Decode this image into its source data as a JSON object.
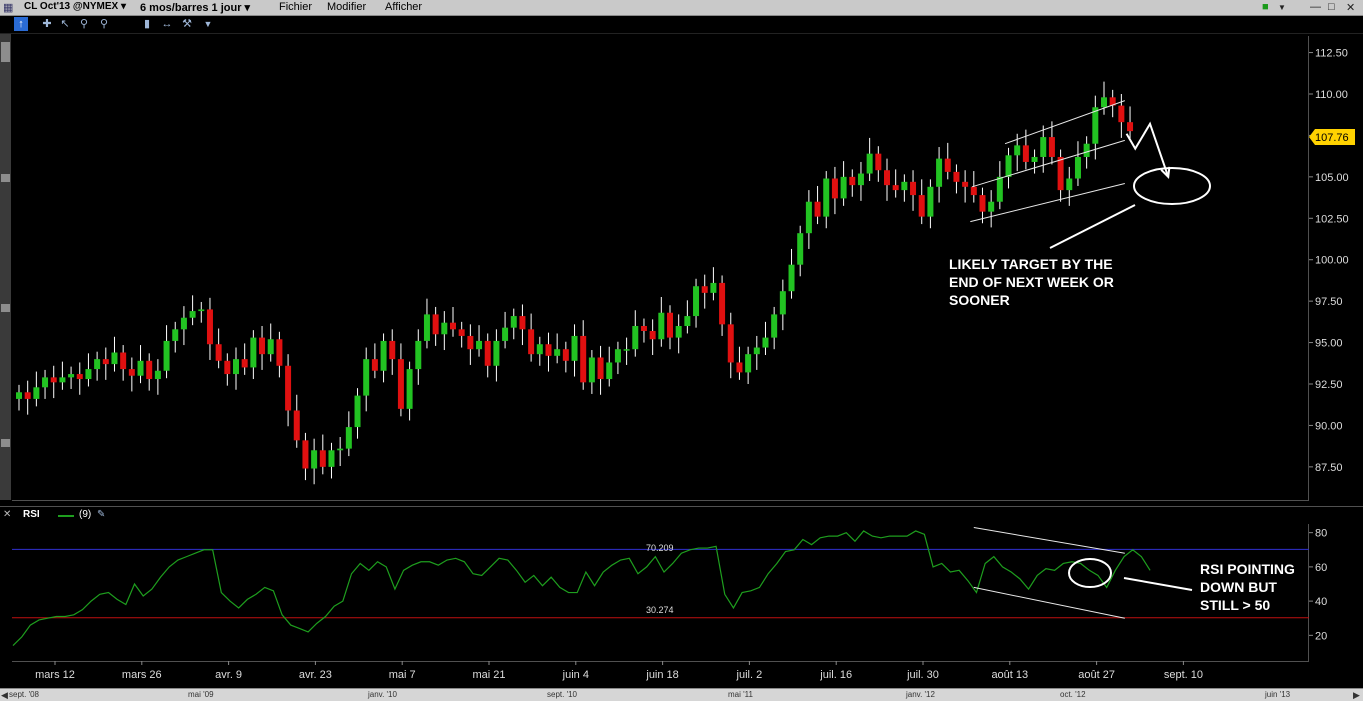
{
  "app": {
    "symbol_menu": "CL Oct'13 @NYMEX",
    "period_menu": "6 mos/barres 1 jour",
    "menu_items": [
      "Fichier",
      "Modifier",
      "Afficher"
    ]
  },
  "price_panel": {
    "last_price_label": "107.76",
    "y_ticks": [
      "112.50",
      "110.00",
      "107.50",
      "105.00",
      "102.50",
      "100.00",
      "97.50",
      "95.00",
      "92.50",
      "90.00",
      "87.50"
    ],
    "annotation": [
      "LIKELY TARGET BY THE",
      "END OF NEXT WEEK OR",
      "SOONER"
    ]
  },
  "rsi_panel": {
    "indicator_label": "RSI",
    "period_label": "(9)",
    "y_ticks": [
      "80",
      "60",
      "40",
      "20"
    ],
    "upper_level_label": "70.209",
    "lower_level_label": "30.274",
    "annotation": [
      "RSI POINTING",
      "DOWN BUT",
      "STILL > 50"
    ]
  },
  "x_axis": {
    "ticks": [
      "mars 12",
      "mars 26",
      "avr. 9",
      "avr. 23",
      "mai 7",
      "mai 21",
      "juin 4",
      "juin 18",
      "juil. 2",
      "juil. 16",
      "juil. 30",
      "août 13",
      "août 27",
      "sept. 10"
    ]
  },
  "overview_scroll": {
    "ticks": [
      "sept. '08",
      "mai '09",
      "janv. '10",
      "sept. '10",
      "mai '11",
      "janv. '12",
      "oct. '12",
      "juin '13"
    ]
  },
  "colors": {
    "up_candle": "#22c322",
    "down_candle": "#e01010",
    "wick": "#ffffff",
    "rsi_line": "#1e9e1e",
    "rsi_upper": "#3030d0",
    "rsi_lower": "#c01010",
    "price_tag": "#ffd200"
  },
  "chart_data": [
    {
      "type": "candlestick",
      "ylim": [
        85.5,
        113.5
      ],
      "closes": [
        92.0,
        91.6,
        92.3,
        92.9,
        92.6,
        92.9,
        93.1,
        92.8,
        93.4,
        94.0,
        93.7,
        94.4,
        93.4,
        93.0,
        93.9,
        92.8,
        93.3,
        95.1,
        95.8,
        96.5,
        96.9,
        97.0,
        94.9,
        93.9,
        93.1,
        94.0,
        93.5,
        95.3,
        94.3,
        95.2,
        93.6,
        90.9,
        89.1,
        87.4,
        88.5,
        87.5,
        88.5,
        88.6,
        89.9,
        91.8,
        94.0,
        93.3,
        95.1,
        94.0,
        91.0,
        93.4,
        95.1,
        96.7,
        95.5,
        96.2,
        95.8,
        95.4,
        94.6,
        95.1,
        93.6,
        95.1,
        95.9,
        96.6,
        95.8,
        94.3,
        94.9,
        94.2,
        94.6,
        93.9,
        95.4,
        92.6,
        94.1,
        92.8,
        93.8,
        94.6,
        94.6,
        96.0,
        95.7,
        95.2,
        96.8,
        95.3,
        96.0,
        96.6,
        98.4,
        98.0,
        98.6,
        96.1,
        93.8,
        93.2,
        94.3,
        94.7,
        95.3,
        96.7,
        98.1,
        99.7,
        101.6,
        103.5,
        102.6,
        104.9,
        103.7,
        105.0,
        104.5,
        105.2,
        106.4,
        105.4,
        104.5,
        104.2,
        104.7,
        103.9,
        102.6,
        104.4,
        106.1,
        105.3,
        104.7,
        104.4,
        103.9,
        102.9,
        103.5,
        105.0,
        106.3,
        106.9,
        105.9,
        106.2,
        107.4,
        106.2,
        104.2,
        104.9,
        106.2,
        107.0,
        109.2,
        109.8,
        109.3,
        108.3,
        107.76
      ],
      "last_price": 107.76,
      "channel": {
        "upper": [
          [
            113.6,
            107.0
          ],
          [
            127.4,
            109.6
          ]
        ],
        "middle": [
          [
            109.8,
            104.4
          ],
          [
            127.4,
            107.2
          ]
        ],
        "lower": [
          [
            109.6,
            102.3
          ],
          [
            127.4,
            104.6
          ]
        ]
      },
      "projection": [
        [
          127.6,
          107.6
        ],
        [
          128.6,
          106.7
        ],
        [
          130.3,
          108.2
        ],
        [
          132.4,
          105.0
        ]
      ]
    },
    {
      "type": "line",
      "name": "RSI",
      "ylim": [
        5,
        95
      ],
      "levels": [
        70.209,
        30.274
      ],
      "values": [
        14,
        19,
        26,
        29,
        30,
        31,
        31,
        32,
        35,
        40,
        44,
        45,
        41,
        38,
        50,
        43,
        47,
        54,
        60,
        64,
        66,
        68,
        70,
        70,
        45,
        40,
        36,
        41,
        44,
        48,
        46,
        32,
        26,
        24,
        22,
        27,
        31,
        37,
        40,
        56,
        62,
        58,
        63,
        60,
        47,
        58,
        61,
        63,
        63,
        61,
        64,
        65,
        63,
        56,
        55,
        60,
        65,
        64,
        58,
        51,
        55,
        49,
        54,
        48,
        45,
        45,
        57,
        49,
        57,
        61,
        64,
        65,
        56,
        60,
        66,
        57,
        62,
        68,
        70,
        71,
        71,
        72,
        44,
        36,
        45,
        46,
        48,
        56,
        62,
        69,
        70,
        76,
        73,
        77,
        78,
        78,
        80,
        75,
        81,
        78,
        77,
        78,
        78,
        78,
        81,
        79,
        60,
        62,
        57,
        58,
        52,
        45,
        62,
        66,
        60,
        57,
        53,
        47,
        55,
        59,
        58,
        62,
        63,
        62,
        58,
        55,
        48,
        58,
        66,
        70,
        66,
        58
      ],
      "trendlines": {
        "upper": [
          [
            110.0,
            83
          ],
          [
            127.4,
            68
          ]
        ],
        "lower": [
          [
            110.0,
            48
          ],
          [
            127.4,
            30
          ]
        ]
      }
    }
  ]
}
